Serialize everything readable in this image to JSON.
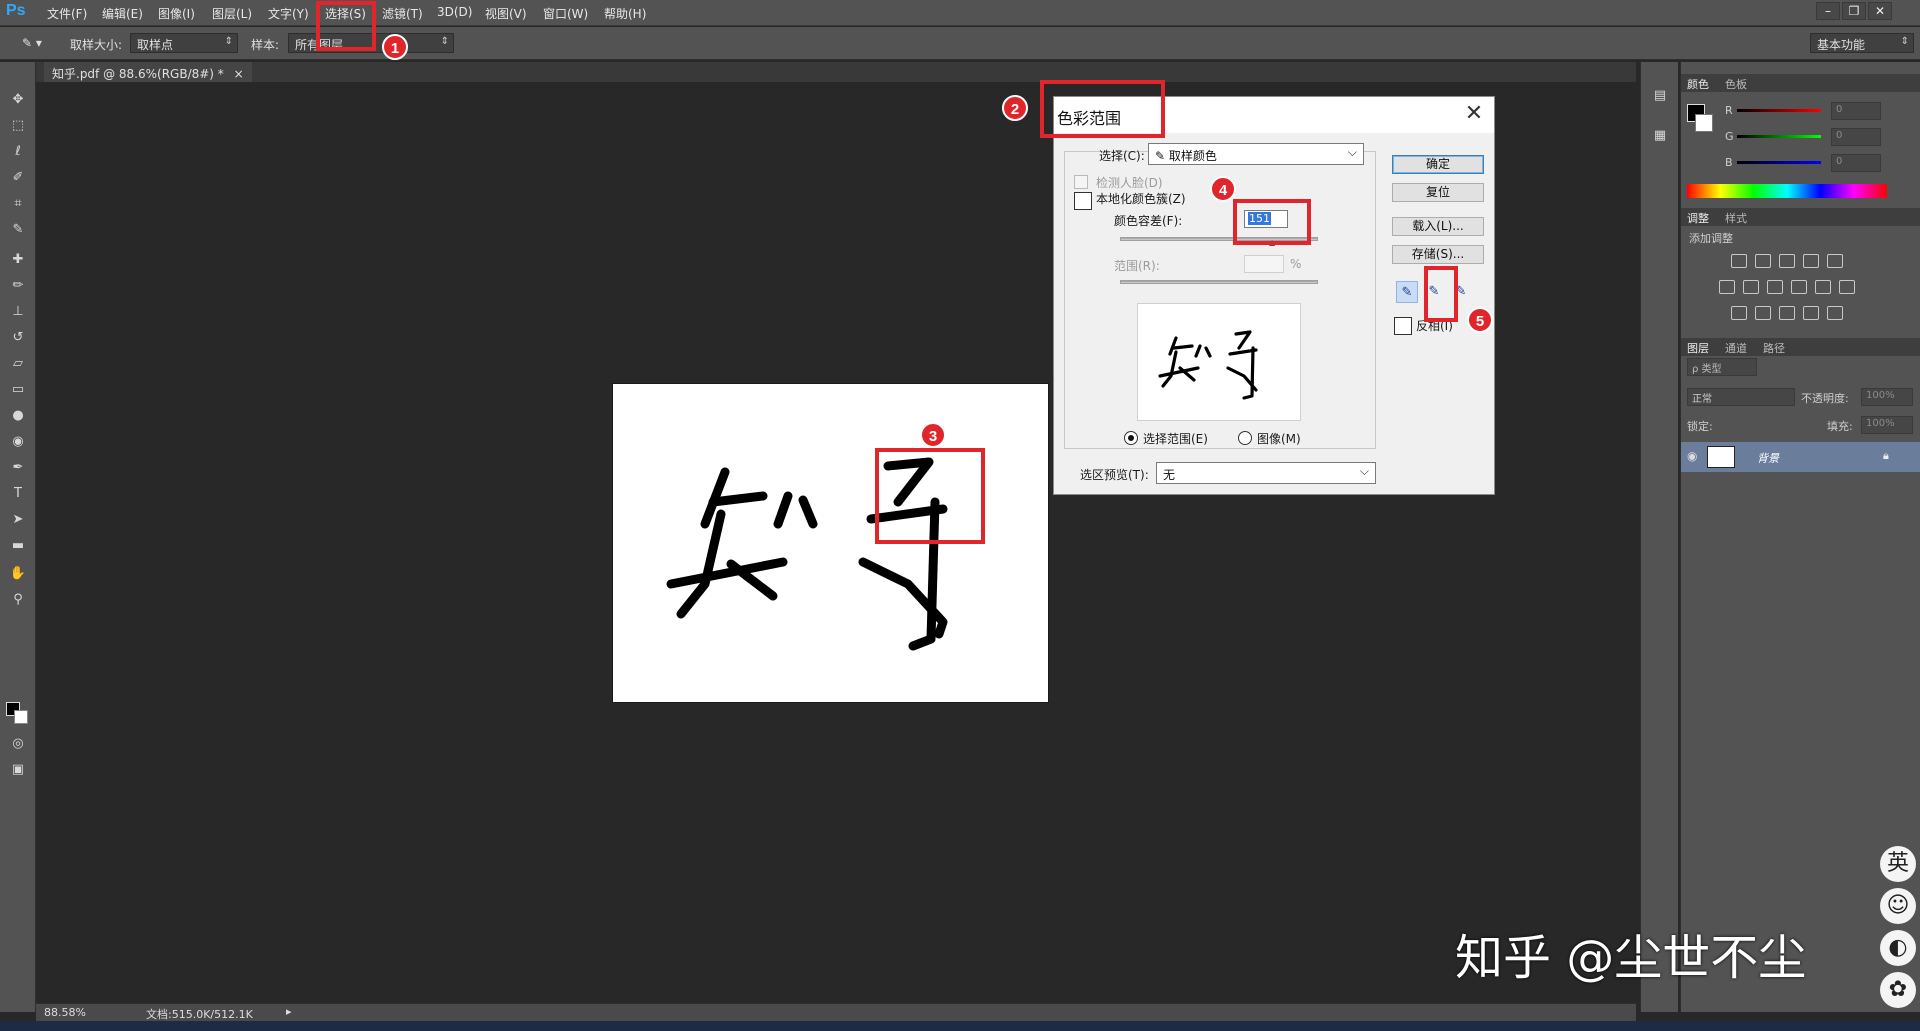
{
  "app": {
    "logo": "Ps",
    "brand_color": "#31a8ff"
  },
  "menu": [
    {
      "label": "文件(F)"
    },
    {
      "label": "编辑(E)"
    },
    {
      "label": "图像(I)"
    },
    {
      "label": "图层(L)"
    },
    {
      "label": "文字(Y)"
    },
    {
      "label": "选择(S)"
    },
    {
      "label": "滤镜(T)"
    },
    {
      "label": "3D(D)"
    },
    {
      "label": "视图(V)"
    },
    {
      "label": "窗口(W)"
    },
    {
      "label": "帮助(H)"
    }
  ],
  "options_bar": {
    "sample_size_label": "取样大小:",
    "sample_size_value": "取样点",
    "sample_label": "样本:",
    "sample_value": "所有图层",
    "workspace": "基本功能"
  },
  "document": {
    "tab_title": "知乎.pdf @ 88.6%(RGB/8#) *",
    "tab_close": "×"
  },
  "status": {
    "zoom": "88.58%",
    "doc_size": "文档:515.0K/512.1K"
  },
  "color_panel": {
    "tabs": [
      "颜色",
      "色板"
    ],
    "channels": [
      {
        "label": "R",
        "value": "0"
      },
      {
        "label": "G",
        "value": "0"
      },
      {
        "label": "B",
        "value": "0"
      }
    ]
  },
  "adjust_panel": {
    "tabs": [
      "调整",
      "样式"
    ],
    "subtitle": "添加调整"
  },
  "layers_panel": {
    "tabs": [
      "图层",
      "通道",
      "路径"
    ],
    "kind_filter": "ρ 类型",
    "blend_mode": "正常",
    "opacity_label": "不透明度:",
    "opacity_value": "100%",
    "lock_label": "锁定:",
    "fill_label": "填充:",
    "fill_value": "100%",
    "layer_name": "背景"
  },
  "dialog": {
    "title": "色彩范围",
    "close": "✕",
    "select_label": "选择(C):",
    "select_value": "取样颜色",
    "detect_faces": "检测人脸(D)",
    "localized": "本地化颜色簇(Z)",
    "fuzziness_label": "颜色容差(F):",
    "fuzziness_value": "151",
    "range_label": "范围(R):",
    "range_unit": "%",
    "preview_text": "知乎",
    "radio_selection": "选择范围(E)",
    "radio_image": "图像(M)",
    "preview_label": "选区预览(T):",
    "preview_value": "无",
    "buttons": {
      "ok": "确定",
      "reset": "复位",
      "load": "载入(L)...",
      "save": "存储(S)..."
    },
    "invert": "反相(I)"
  },
  "markers": [
    "1",
    "2",
    "3",
    "4",
    "5"
  ],
  "canvas_text": "知乎",
  "watermark": "知乎 @尘世不尘",
  "side_bubbles": [
    "英",
    "☺",
    "◐",
    "✿",
    "✾"
  ],
  "colors": {
    "annotation_red": "#e0262b",
    "panel_bg": "#535353",
    "canvas_bg": "#282828"
  }
}
